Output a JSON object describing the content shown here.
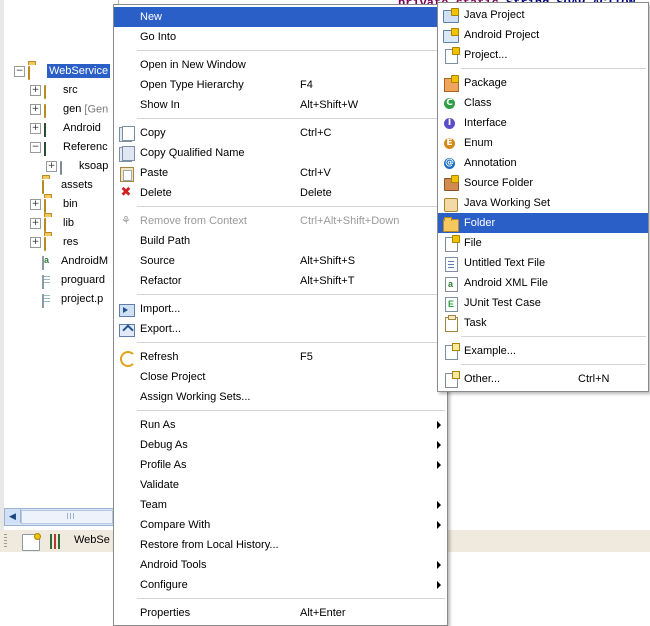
{
  "editor": {
    "code_keyword": "private static",
    "code_rest": " String SOAP_ACTION"
  },
  "explorer": {
    "scrollbar_left_arrow": "◀",
    "tree": [
      {
        "label": "WebService",
        "icon": "project-folder-icon",
        "indent": 0,
        "twisty": "−",
        "selected": true,
        "suffix": ""
      },
      {
        "label": "src",
        "icon": "source-folder-icon",
        "indent": 1,
        "twisty": "+",
        "selected": false,
        "suffix": ""
      },
      {
        "label": "gen ",
        "icon": "source-folder-icon",
        "indent": 1,
        "twisty": "+",
        "selected": false,
        "suffix": "[Gen"
      },
      {
        "label": "Android",
        "icon": "library-icon",
        "indent": 1,
        "twisty": "+",
        "selected": false,
        "suffix": ""
      },
      {
        "label": "Referenc",
        "icon": "library-icon",
        "indent": 1,
        "twisty": "−",
        "selected": false,
        "suffix": ""
      },
      {
        "label": "ksoap",
        "icon": "jar-icon",
        "indent": 2,
        "twisty": "+",
        "selected": false,
        "suffix": ""
      },
      {
        "label": "assets",
        "icon": "folder-icon",
        "indent": 1,
        "twisty": "",
        "selected": false,
        "suffix": ""
      },
      {
        "label": "bin",
        "icon": "folder-icon",
        "indent": 1,
        "twisty": "+",
        "selected": false,
        "suffix": ""
      },
      {
        "label": "lib",
        "icon": "folder-icon",
        "indent": 1,
        "twisty": "+",
        "selected": false,
        "suffix": ""
      },
      {
        "label": "res",
        "icon": "folder-icon",
        "indent": 1,
        "twisty": "+",
        "selected": false,
        "suffix": ""
      },
      {
        "label": "AndroidM",
        "icon": "android-xml-icon",
        "indent": 1,
        "twisty": "",
        "selected": false,
        "suffix": ""
      },
      {
        "label": "proguard",
        "icon": "file-icon",
        "indent": 1,
        "twisty": "",
        "selected": false,
        "suffix": ""
      },
      {
        "label": "project.p",
        "icon": "file-icon",
        "indent": 1,
        "twisty": "",
        "selected": false,
        "suffix": ""
      }
    ]
  },
  "bottom_bar": {
    "view_label": "WebSe",
    "icons": [
      "new-view-icon",
      "filters-icon"
    ]
  },
  "context_menu": {
    "items": [
      {
        "label": "New",
        "shortcut": "",
        "icon": "",
        "submenu": true,
        "selected": true,
        "disabled": false
      },
      {
        "label": "Go Into",
        "shortcut": "",
        "icon": "",
        "submenu": false,
        "selected": false,
        "disabled": false
      },
      {
        "separator": true
      },
      {
        "label": "Open in New Window",
        "shortcut": "",
        "icon": "",
        "submenu": false,
        "selected": false,
        "disabled": false
      },
      {
        "label": "Open Type Hierarchy",
        "shortcut": "F4",
        "icon": "",
        "submenu": false,
        "selected": false,
        "disabled": false
      },
      {
        "label": "Show In",
        "shortcut": "Alt+Shift+W",
        "icon": "",
        "submenu": true,
        "selected": false,
        "disabled": false
      },
      {
        "separator": true
      },
      {
        "label": "Copy",
        "shortcut": "Ctrl+C",
        "icon": "copy-icon",
        "submenu": false,
        "selected": false,
        "disabled": false
      },
      {
        "label": "Copy Qualified Name",
        "shortcut": "",
        "icon": "copy-qualified-name-icon",
        "submenu": false,
        "selected": false,
        "disabled": false
      },
      {
        "label": "Paste",
        "shortcut": "Ctrl+V",
        "icon": "paste-icon",
        "submenu": false,
        "selected": false,
        "disabled": false
      },
      {
        "label": "Delete",
        "shortcut": "Delete",
        "icon": "delete-icon",
        "submenu": false,
        "selected": false,
        "disabled": false
      },
      {
        "separator": true
      },
      {
        "label": "Remove from Context",
        "shortcut": "Ctrl+Alt+Shift+Down",
        "icon": "remove-from-context-icon",
        "submenu": false,
        "selected": false,
        "disabled": true
      },
      {
        "label": "Build Path",
        "shortcut": "",
        "icon": "",
        "submenu": true,
        "selected": false,
        "disabled": false
      },
      {
        "label": "Source",
        "shortcut": "Alt+Shift+S",
        "icon": "",
        "submenu": true,
        "selected": false,
        "disabled": false
      },
      {
        "label": "Refactor",
        "shortcut": "Alt+Shift+T",
        "icon": "",
        "submenu": true,
        "selected": false,
        "disabled": false
      },
      {
        "separator": true
      },
      {
        "label": "Import...",
        "shortcut": "",
        "icon": "import-icon",
        "submenu": false,
        "selected": false,
        "disabled": false
      },
      {
        "label": "Export...",
        "shortcut": "",
        "icon": "export-icon",
        "submenu": false,
        "selected": false,
        "disabled": false
      },
      {
        "separator": true
      },
      {
        "label": "Refresh",
        "shortcut": "F5",
        "icon": "refresh-icon",
        "submenu": false,
        "selected": false,
        "disabled": false
      },
      {
        "label": "Close Project",
        "shortcut": "",
        "icon": "",
        "submenu": false,
        "selected": false,
        "disabled": false
      },
      {
        "label": "Assign Working Sets...",
        "shortcut": "",
        "icon": "",
        "submenu": false,
        "selected": false,
        "disabled": false
      },
      {
        "separator": true
      },
      {
        "label": "Run As",
        "shortcut": "",
        "icon": "",
        "submenu": true,
        "selected": false,
        "disabled": false
      },
      {
        "label": "Debug As",
        "shortcut": "",
        "icon": "",
        "submenu": true,
        "selected": false,
        "disabled": false
      },
      {
        "label": "Profile As",
        "shortcut": "",
        "icon": "",
        "submenu": true,
        "selected": false,
        "disabled": false
      },
      {
        "label": "Validate",
        "shortcut": "",
        "icon": "",
        "submenu": false,
        "selected": false,
        "disabled": false
      },
      {
        "label": "Team",
        "shortcut": "",
        "icon": "",
        "submenu": true,
        "selected": false,
        "disabled": false
      },
      {
        "label": "Compare With",
        "shortcut": "",
        "icon": "",
        "submenu": true,
        "selected": false,
        "disabled": false
      },
      {
        "label": "Restore from Local History...",
        "shortcut": "",
        "icon": "",
        "submenu": false,
        "selected": false,
        "disabled": false
      },
      {
        "label": "Android Tools",
        "shortcut": "",
        "icon": "",
        "submenu": true,
        "selected": false,
        "disabled": false
      },
      {
        "label": "Configure",
        "shortcut": "",
        "icon": "",
        "submenu": true,
        "selected": false,
        "disabled": false
      },
      {
        "separator": true
      },
      {
        "label": "Properties",
        "shortcut": "Alt+Enter",
        "icon": "",
        "submenu": false,
        "selected": false,
        "disabled": false
      }
    ]
  },
  "new_submenu": {
    "items": [
      {
        "label": "Java Project",
        "shortcut": "",
        "icon": "java-project-icon",
        "selected": false
      },
      {
        "label": "Android Project",
        "shortcut": "",
        "icon": "android-project-icon",
        "selected": false
      },
      {
        "label": "Project...",
        "shortcut": "",
        "icon": "project-icon",
        "selected": false
      },
      {
        "separator": true
      },
      {
        "label": "Package",
        "shortcut": "",
        "icon": "package-icon",
        "selected": false
      },
      {
        "label": "Class",
        "shortcut": "",
        "icon": "class-icon",
        "selected": false
      },
      {
        "label": "Interface",
        "shortcut": "",
        "icon": "interface-icon",
        "selected": false
      },
      {
        "label": "Enum",
        "shortcut": "",
        "icon": "enum-icon",
        "selected": false
      },
      {
        "label": "Annotation",
        "shortcut": "",
        "icon": "annotation-icon",
        "selected": false
      },
      {
        "label": "Source Folder",
        "shortcut": "",
        "icon": "source-folder-icon",
        "selected": false
      },
      {
        "label": "Java Working Set",
        "shortcut": "",
        "icon": "java-working-set-icon",
        "selected": false
      },
      {
        "label": "Folder",
        "shortcut": "",
        "icon": "folder-icon",
        "selected": true
      },
      {
        "label": "File",
        "shortcut": "",
        "icon": "file-icon",
        "selected": false
      },
      {
        "label": "Untitled Text File",
        "shortcut": "",
        "icon": "text-file-icon",
        "selected": false
      },
      {
        "label": "Android XML File",
        "shortcut": "",
        "icon": "android-xml-icon",
        "selected": false
      },
      {
        "label": "JUnit Test Case",
        "shortcut": "",
        "icon": "junit-icon",
        "selected": false
      },
      {
        "label": "Task",
        "shortcut": "",
        "icon": "task-icon",
        "selected": false
      },
      {
        "separator": true
      },
      {
        "label": "Example...",
        "shortcut": "",
        "icon": "example-icon",
        "selected": false
      },
      {
        "separator": true
      },
      {
        "label": "Other...",
        "shortcut": "Ctrl+N",
        "icon": "other-icon",
        "selected": false
      }
    ]
  }
}
